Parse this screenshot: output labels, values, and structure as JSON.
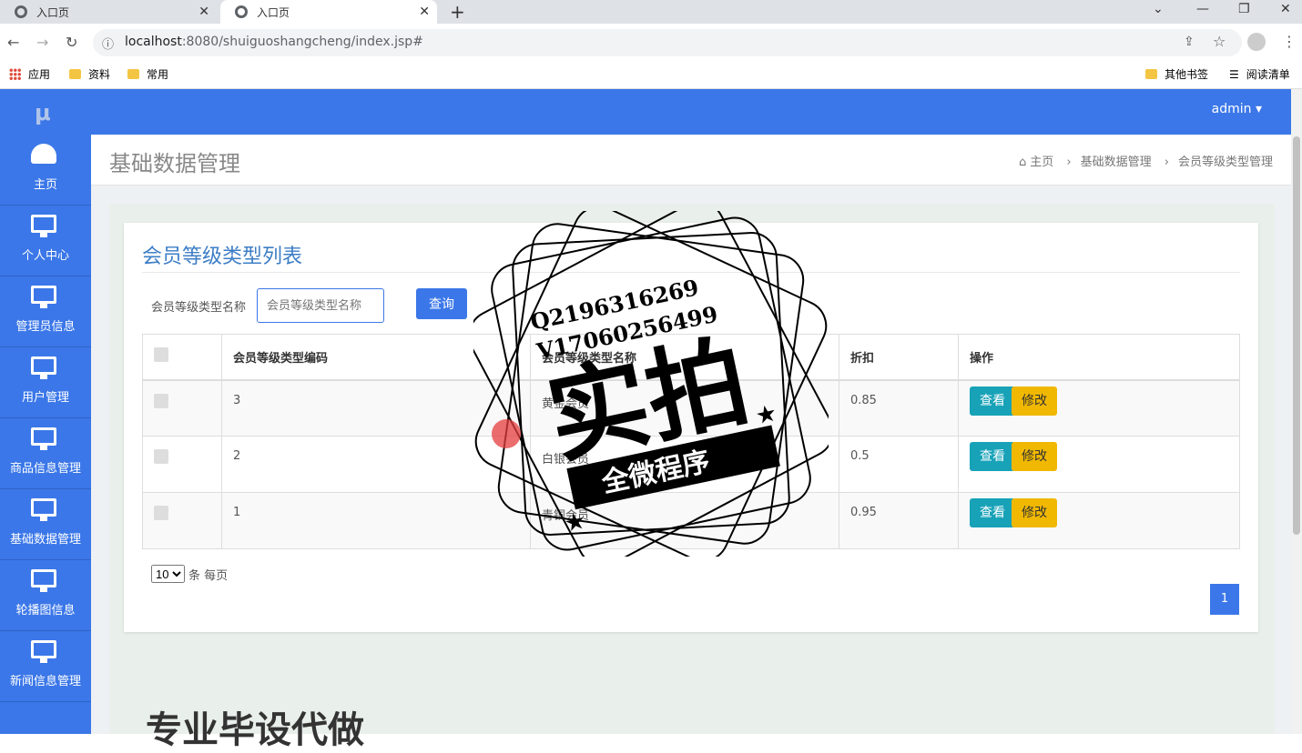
{
  "browser": {
    "tabs": [
      {
        "title": "入口页"
      },
      {
        "title": "入口页"
      }
    ],
    "url_host": "localhost",
    "url_rest": ":8080/shuiguoshangcheng/index.jsp#",
    "bookmarks": [
      "应用",
      "资料",
      "常用"
    ],
    "bookmarks_right": [
      "其他书签",
      "阅读清单"
    ]
  },
  "app": {
    "logo": "μ",
    "user": "admin"
  },
  "sidebar": {
    "items": [
      {
        "label": "主页",
        "icon": "dashboard-icon"
      },
      {
        "label": "个人中心",
        "icon": "monitor-icon"
      },
      {
        "label": "管理员信息",
        "icon": "monitor-icon"
      },
      {
        "label": "用户管理",
        "icon": "monitor-icon"
      },
      {
        "label": "商品信息管理",
        "icon": "monitor-icon"
      },
      {
        "label": "基础数据管理",
        "icon": "monitor-icon"
      },
      {
        "label": "轮播图信息",
        "icon": "monitor-icon"
      },
      {
        "label": "新闻信息管理",
        "icon": "monitor-icon"
      }
    ]
  },
  "page": {
    "title": "基础数据管理",
    "breadcrumb": [
      "主页",
      "基础数据管理",
      "会员等级类型管理"
    ]
  },
  "list": {
    "title": "会员等级类型列表",
    "search_label": "会员等级类型名称",
    "search_placeholder": "会员等级类型名称",
    "search_button": "查询",
    "columns": [
      "会员等级类型编码",
      "会员等级类型名称",
      "折扣",
      "操作"
    ],
    "rows": [
      {
        "code": "3",
        "name": "黄金会员",
        "discount": "0.85"
      },
      {
        "code": "2",
        "name": "白银会员",
        "discount": "0.5"
      },
      {
        "code": "1",
        "name": "青铜会员",
        "discount": "0.95"
      }
    ],
    "view_label": "查看",
    "edit_label": "修改",
    "page_size": "10",
    "page_size_suffix": "条 每页",
    "current_page": "1"
  },
  "watermark": {
    "line1": "Q2196316269",
    "line2": "V17060256499",
    "main": "实拍",
    "banner": "全微程序"
  },
  "footer_text": "专业毕设代做"
}
